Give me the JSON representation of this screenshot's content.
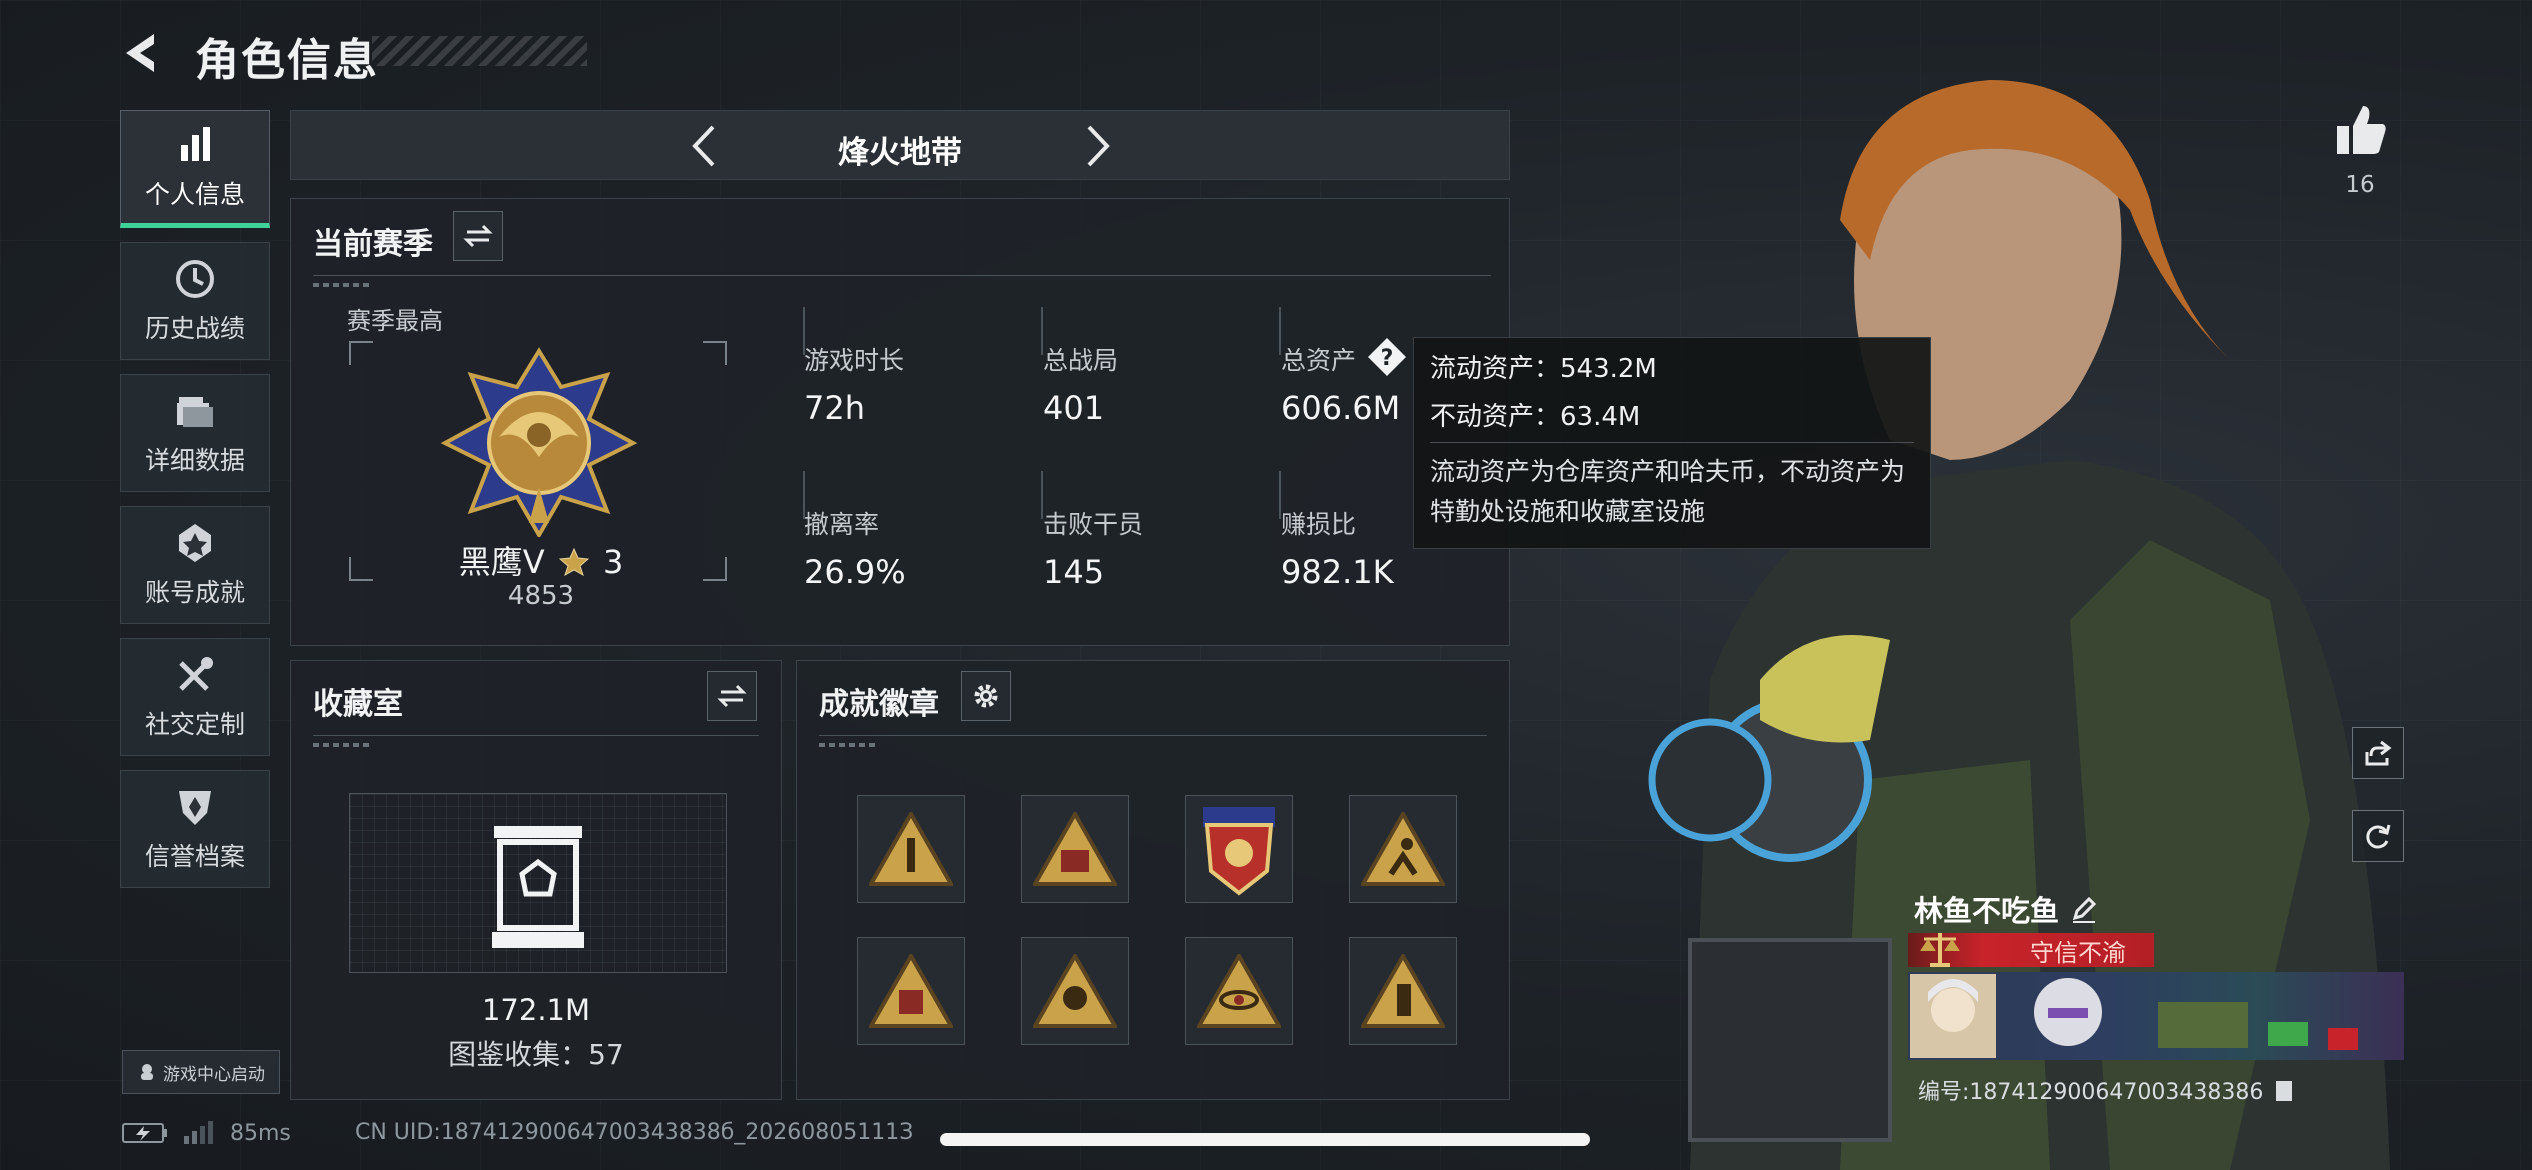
{
  "header": {
    "title": "角色信息"
  },
  "sidebar": {
    "items": [
      {
        "label": "个人信息",
        "icon": "bar-chart-icon",
        "active": true
      },
      {
        "label": "历史战绩",
        "icon": "clock-icon",
        "active": false
      },
      {
        "label": "详细数据",
        "icon": "folder-icon",
        "active": false
      },
      {
        "label": "账号成就",
        "icon": "medal-icon",
        "active": false
      },
      {
        "label": "社交定制",
        "icon": "tools-icon",
        "active": false
      },
      {
        "label": "信誉档案",
        "icon": "shield-icon",
        "active": false
      }
    ],
    "launch_label": "游戏中心启动"
  },
  "status": {
    "ping": "85ms",
    "uid": "CN UID:18741290064700343838б_20260805111З"
  },
  "mode": {
    "title": "烽火地带"
  },
  "season": {
    "title": "当前赛季",
    "sub_label": "赛季最高",
    "rank_name": "黑鹰V",
    "rank_stars": "3",
    "rank_score": "4853",
    "stats": [
      {
        "label": "游戏时长",
        "value": "72h"
      },
      {
        "label": "总战局",
        "value": "401"
      },
      {
        "label": "总资产",
        "value": "606.6M"
      },
      {
        "label": "撤离率",
        "value": "26.9%"
      },
      {
        "label": "击败干员",
        "value": "145"
      },
      {
        "label": "赚损比",
        "value": "982.1K"
      }
    ]
  },
  "tooltip": {
    "liquid": "流动资产：543.2M",
    "fixed": "不动资产：63.4M",
    "description": "流动资产为仓库资产和哈夫币，不动资产为特勤处设施和收藏室设施"
  },
  "collection": {
    "title": "收藏室",
    "value": "172.1M",
    "count": "图鉴收集：57"
  },
  "achievements": {
    "title": "成就徽章"
  },
  "profile": {
    "likes": "16",
    "player_name": "林鱼不吃鱼",
    "title_tag": "守信不渝",
    "player_id": "编号:187412900647003438386"
  },
  "colors": {
    "accent": "#3fd19a",
    "tag_red": "#c8232a",
    "medal_gold": "#c9a24a"
  }
}
